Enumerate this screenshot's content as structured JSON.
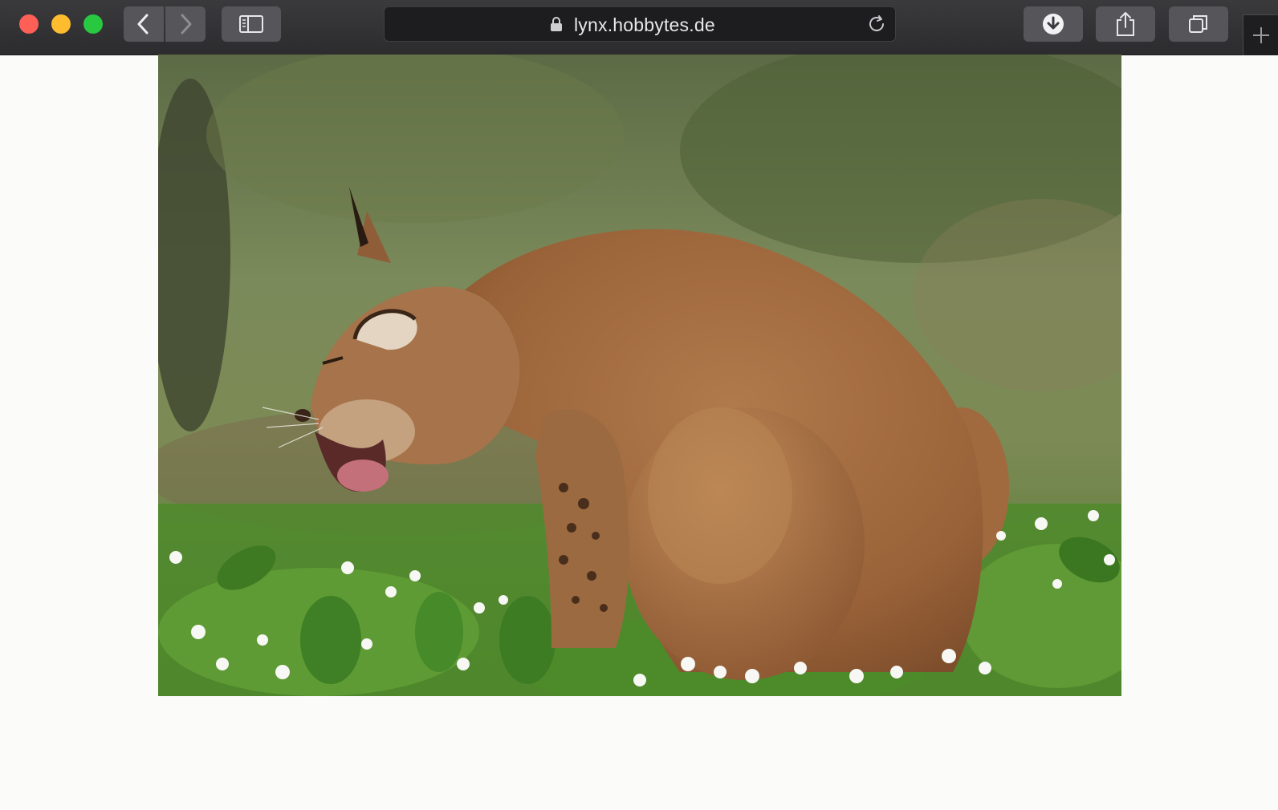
{
  "browser": {
    "address_bar": {
      "url": "lynx.hobbytes.de"
    },
    "icons": {
      "back": "chevron-left-icon",
      "forward": "chevron-right-icon",
      "sidebar": "sidebar-icon",
      "lock": "lock-icon",
      "reload": "reload-icon",
      "downloads": "download-icon",
      "share": "share-icon",
      "tabs": "tabs-overview-icon",
      "new_tab": "plus-icon"
    }
  },
  "page": {
    "image": {
      "subject": "lynx"
    }
  }
}
